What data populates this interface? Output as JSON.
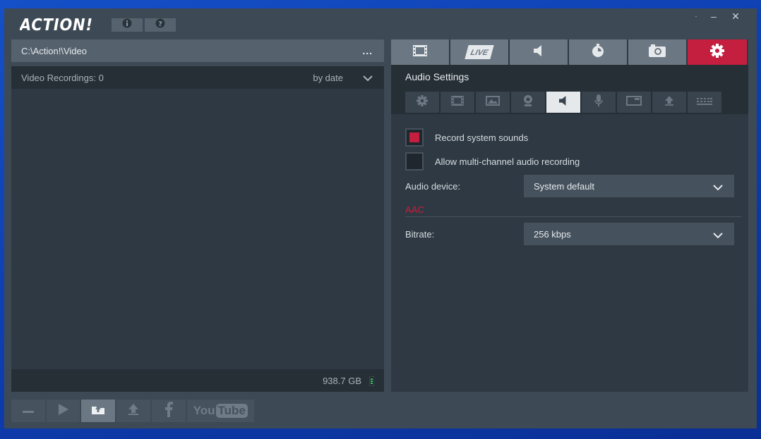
{
  "app": {
    "logo_text": "ACTION!"
  },
  "title_buttons": [
    {
      "icon": "info-icon"
    },
    {
      "icon": "help-icon"
    }
  ],
  "window_controls": {
    "dot": "·",
    "minimize": "–",
    "close": "✕"
  },
  "left": {
    "path": "C:\\Action!\\Video",
    "more_label": "...",
    "recordings_label": "Video Recordings: 0",
    "sort_label": "by date",
    "disk_free": "938.7 GB"
  },
  "bottom_toolbar": [
    {
      "icon": "minus-icon"
    },
    {
      "icon": "play-icon"
    },
    {
      "icon": "upload-folder-icon"
    },
    {
      "icon": "upload-icon"
    },
    {
      "icon": "facebook-icon"
    },
    {
      "icon": "youtube-icon",
      "label_you": "You",
      "label_tube": "Tube"
    }
  ],
  "top_tabs": [
    {
      "icon": "film-icon"
    },
    {
      "icon": "live-icon",
      "label": "LIVE"
    },
    {
      "icon": "speaker-icon"
    },
    {
      "icon": "stopwatch-icon"
    },
    {
      "icon": "camera-icon"
    },
    {
      "icon": "gear-icon",
      "active": true
    }
  ],
  "audio": {
    "title": "Audio Settings",
    "sub_tabs": [
      "gear-icon",
      "film-icon",
      "image-icon",
      "webcam-icon",
      "speaker-icon",
      "microphone-icon",
      "window-icon",
      "upload-icon",
      "keyboard-icon"
    ],
    "record_system_sounds": {
      "label": "Record system sounds",
      "checked": true
    },
    "multichannel": {
      "label": "Allow multi-channel audio recording",
      "checked": false
    },
    "device_label": "Audio device:",
    "device_value": "System default",
    "section_aac": "AAC",
    "bitrate_label": "Bitrate:",
    "bitrate_value": "256 kbps"
  },
  "colors": {
    "accent": "#c41f3e",
    "panel": "#2f3943",
    "dark": "#262e36"
  }
}
